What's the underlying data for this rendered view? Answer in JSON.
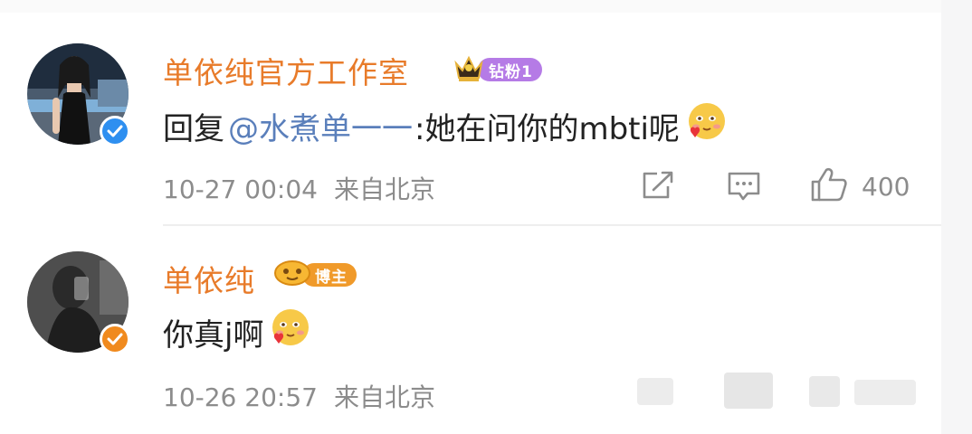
{
  "comments": [
    {
      "name": "单依纯官方工作室",
      "badge": {
        "label": "钻粉1",
        "icon": "crown-icon",
        "color": "#b57be6"
      },
      "reply_prefix": "回复",
      "mention": "@水煮单一一",
      "text": ":她在问你的mbti呢",
      "emoji": "blush-heart-emoji",
      "timestamp": "10-27 00:04",
      "location": "来自北京",
      "actions": {
        "share_icon": "share-icon",
        "comment_icon": "comment-icon",
        "like_icon": "thumbs-up-icon",
        "like_count": "400"
      },
      "verify_color": "#2e8ff0"
    },
    {
      "name": "单依纯",
      "badge": {
        "label": "博主",
        "icon": "trophy-icon",
        "color": "#f09a2a"
      },
      "text": "你真j啊",
      "emoji": "blush-heart-emoji",
      "timestamp": "10-26 20:57",
      "location": "来自北京",
      "verify_color": "#f08a1e"
    }
  ],
  "colors": {
    "name": "#e87b2a",
    "mention": "#5a7fbb",
    "meta": "#8c8c8c"
  }
}
